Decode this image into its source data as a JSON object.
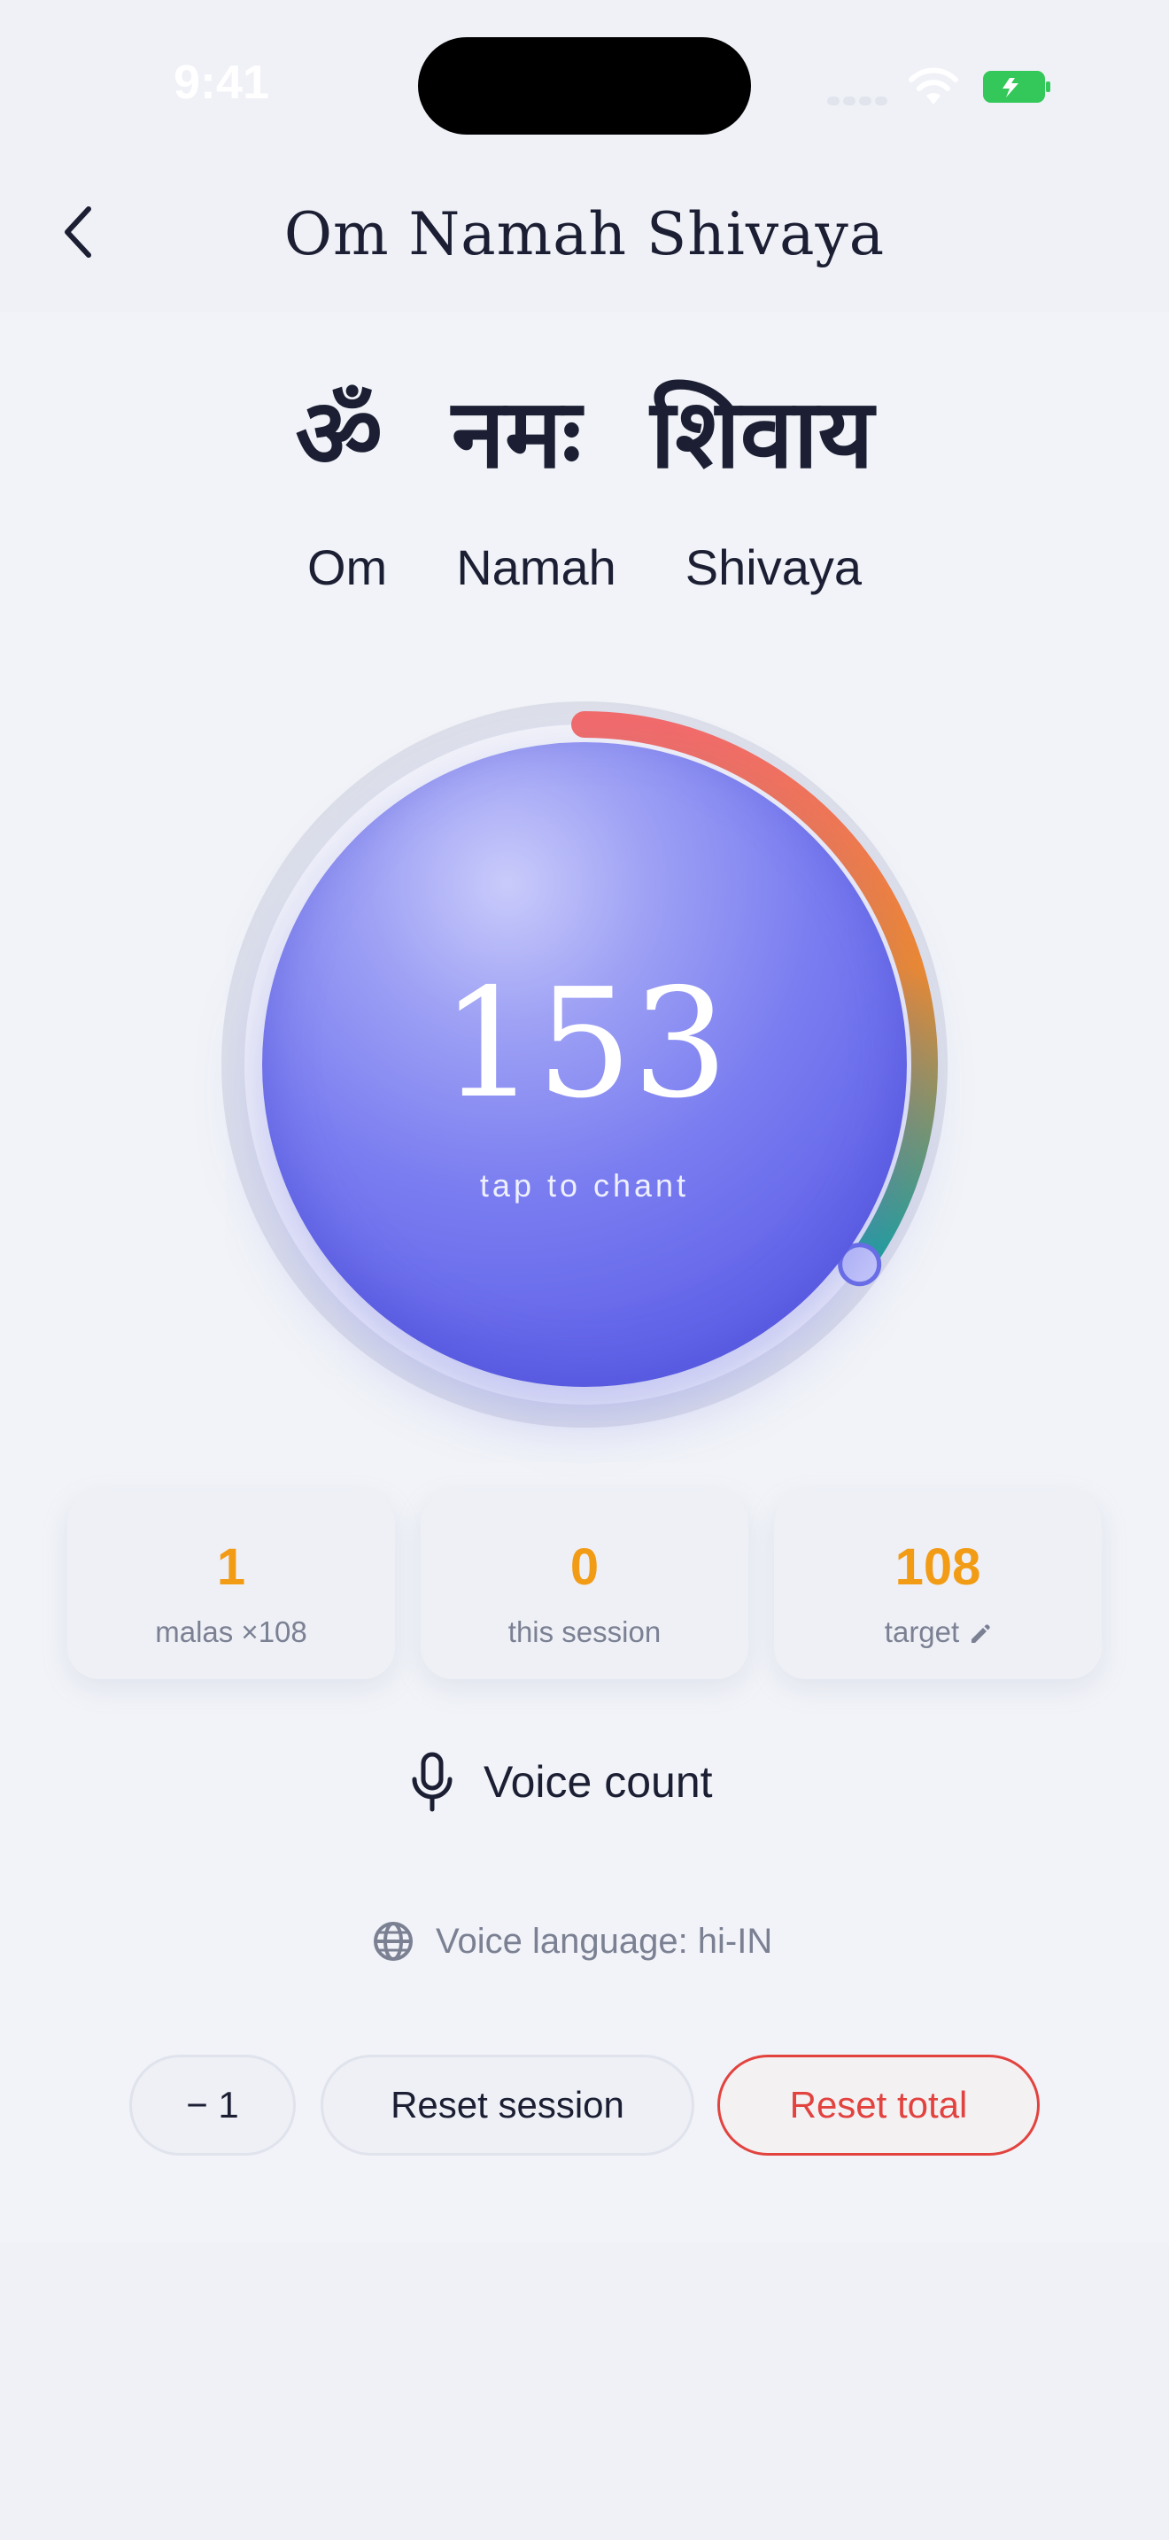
{
  "status_bar": {
    "time": "9:41"
  },
  "header": {
    "title": "Om Namah Shivaya",
    "back_icon": "chevron-left-icon"
  },
  "mantra": {
    "devanagari": [
      "ॐ",
      "नमः",
      "शिवाय"
    ],
    "transliteration": [
      "Om",
      "Namah",
      "Shivaya"
    ]
  },
  "counter": {
    "count": "153",
    "hint": "tap to chant",
    "progress_fraction": 0.35,
    "colors": {
      "ring_start": "#f26b6b",
      "ring_mid": "#ee8a2e",
      "ring_end": "#18a39b",
      "button": "#5f63e8"
    }
  },
  "stats": [
    {
      "value": "1",
      "label": "malas ×108"
    },
    {
      "value": "0",
      "label": "this session"
    },
    {
      "value": "108",
      "label": "target",
      "icon": "pencil-icon"
    }
  ],
  "voice": {
    "count_label": "Voice count",
    "language_label": "Voice language: hi-IN"
  },
  "actions": {
    "minus_label": "− 1",
    "reset_session_label": "Reset session",
    "reset_total_label": "Reset total",
    "danger_color": "#e2433f"
  },
  "accent_color": "#f29b15"
}
